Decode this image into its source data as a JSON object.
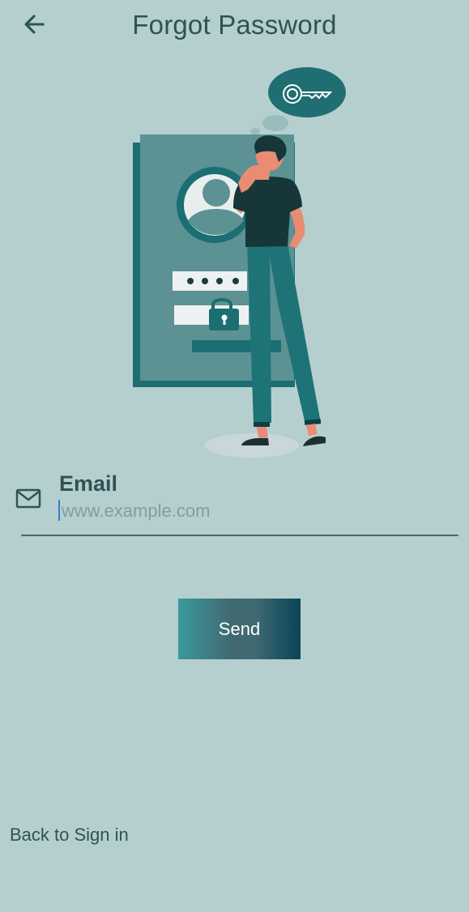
{
  "header": {
    "title": "Forgot Password",
    "back_icon": "arrow-left-icon"
  },
  "illustration": {
    "icon": "forgot-password-illustration"
  },
  "form": {
    "email_icon": "mail-icon",
    "email_label": "Email",
    "email_placeholder": "www.example.com",
    "email_value": "",
    "send_label": "Send"
  },
  "footer": {
    "back_to_signin_label": "Back to Sign in"
  },
  "colors": {
    "background": "#b5cfcf",
    "text": "#2f5355",
    "primary": "#1a6e72",
    "button_gradient_start": "#3a999c",
    "button_gradient_end": "#0a4457"
  }
}
